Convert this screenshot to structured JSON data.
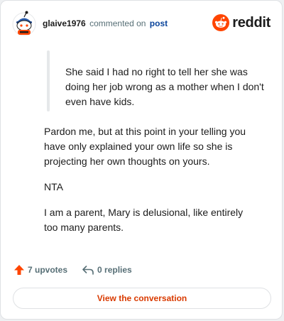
{
  "header": {
    "username": "glaive1976",
    "action_text": "commented on",
    "post_link": "post",
    "brand": "reddit"
  },
  "quote": {
    "text": "She said I had no right to tell her she was doing her job wrong as a mother when I don't even have kids."
  },
  "comment": {
    "paragraphs": [
      "Pardon me, but at this point in your telling you have only explained your own life so she is projecting her own thoughts on yours.",
      "NTA",
      "I am a parent, Mary is delusional, like entirely too many parents."
    ]
  },
  "actions": {
    "upvotes": "7 upvotes",
    "replies": "0 replies"
  },
  "footer": {
    "view_button": "View the conversation"
  },
  "colors": {
    "brand_orange": "#ff4500",
    "link_blue": "#0a449b",
    "button_text": "#d93a00"
  },
  "icons": {
    "avatar": "snoo-avatar-icon",
    "brand": "reddit-logo-icon",
    "upvote": "upvote-arrow-icon",
    "reply": "reply-arrow-icon"
  }
}
